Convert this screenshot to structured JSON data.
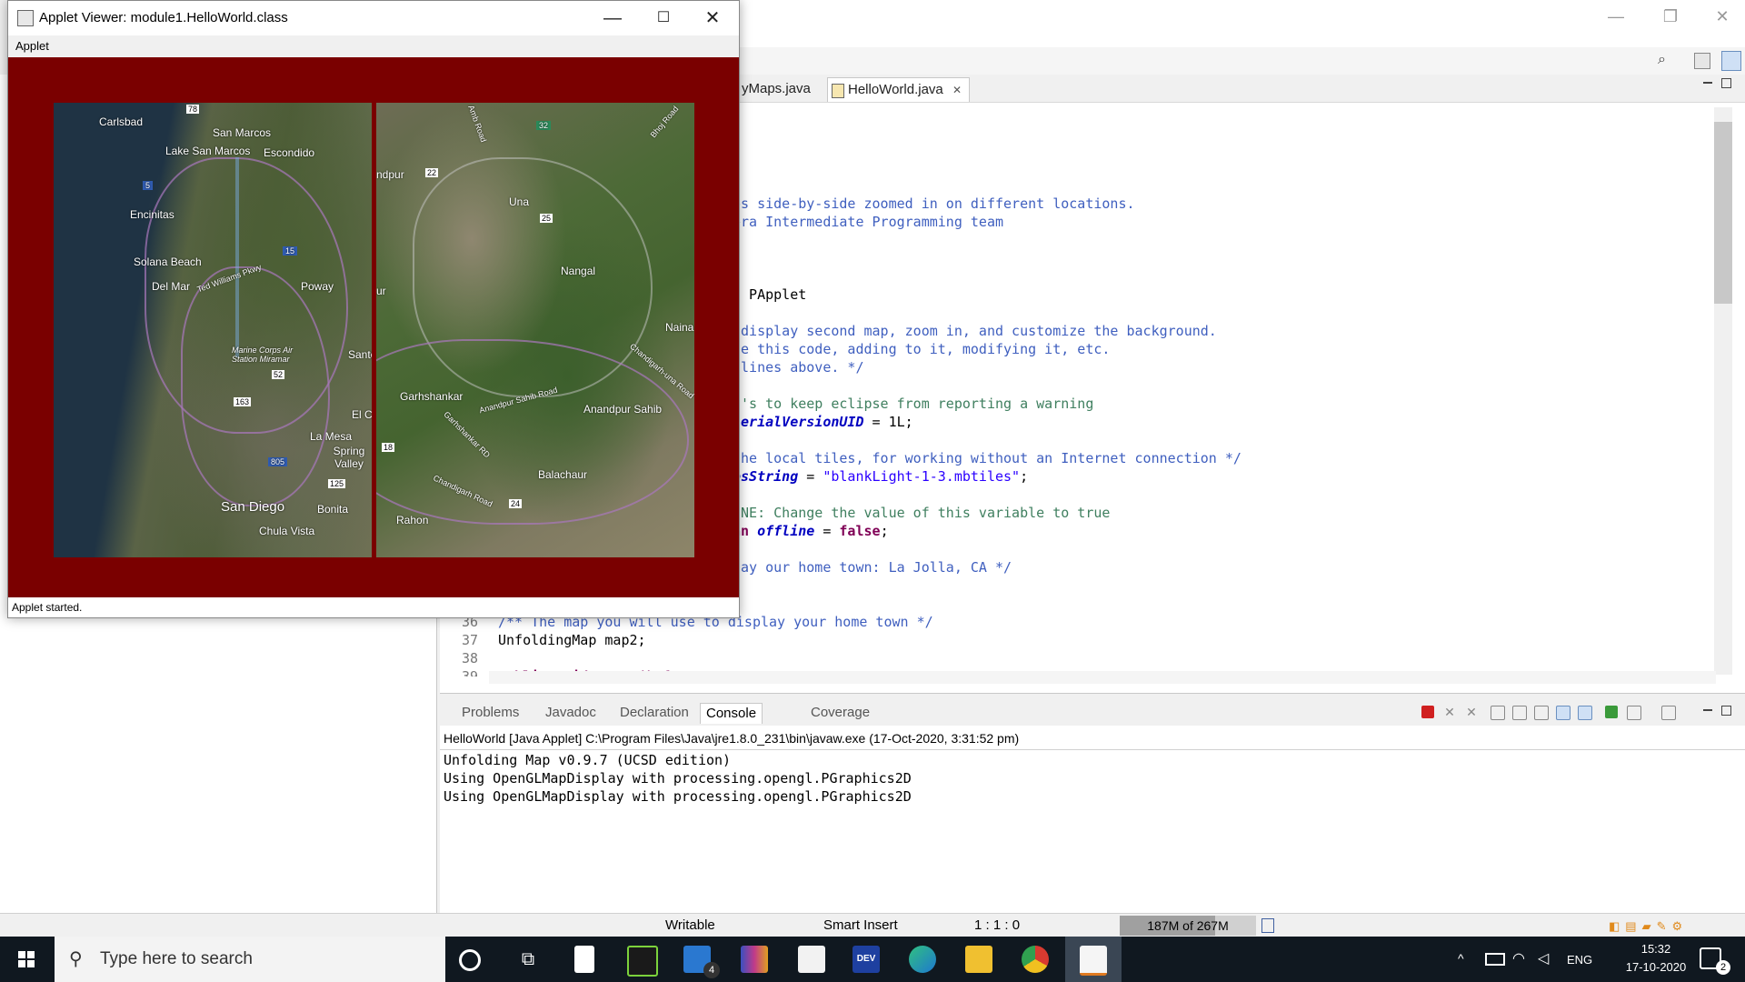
{
  "eclipse": {
    "tabs": [
      "yMaps.java",
      "HelloWorld.java"
    ],
    "code": [
      {
        "n": "",
        "t": "s",
        "cls": "kw"
      },
      {
        "n": "",
        "t": "ps side-by-side zoomed in on different locations.",
        "cls": "cmt"
      },
      {
        "n": "",
        "t": "era Intermediate Programming team",
        "cls": "cmt"
      },
      {
        "n": "",
        "t": "s PApplet",
        "cls": ""
      },
      {
        "n": "",
        "t": " display second map, zoom in, and customize the background.",
        "cls": "cmt"
      },
      {
        "n": "",
        "t": "se this code, adding to it, modifying it, etc.",
        "cls": "cmt"
      },
      {
        "n": "",
        "t": " lines above. */",
        "cls": "cmt"
      },
      {
        "n": "",
        "t": "t's to keep eclipse from reporting a warning",
        "cls": "cmt2"
      },
      {
        "n": "",
        "t": "serialVersionUID",
        "cls": "fld",
        "tail": " = 1L;"
      },
      {
        "n": "",
        "t": "the local tiles, for working without an Internet connection */",
        "cls": "cmt"
      },
      {
        "n": "",
        "t": "esString",
        "cls": "fld",
        "tail": " = ",
        "str": "\"blankLight-1-3.mbtiles\"",
        "tail2": ";"
      },
      {
        "n": "",
        "t": "INE: Change the value of this variable to true",
        "cls": "cmt2"
      },
      {
        "n": "",
        "t": "an ",
        "cls": "kw",
        "fld": "offline",
        "tail": " = ",
        "kw2": "false",
        "tail2": ";"
      },
      {
        "n": "",
        "t": "lay our home town: La Jolla, CA */",
        "cls": "cmt"
      },
      {
        "n": "36",
        "t": "/** The map you will use to display your home town */",
        "cls": "cmt"
      },
      {
        "n": "37",
        "t": "UnfoldingMap map2;",
        "cls": ""
      },
      {
        "n": "38",
        "t": "",
        "cls": ""
      },
      {
        "n": "39",
        "t": "public void setup() {",
        "cls": "kw"
      }
    ],
    "console_tabs": [
      "Problems",
      "Javadoc",
      "Declaration",
      "Console",
      "Coverage"
    ],
    "console_desc": "HelloWorld [Java Applet] C:\\Program Files\\Java\\jre1.8.0_231\\bin\\javaw.exe (17-Oct-2020, 3:31:52 pm)",
    "console_out": [
      "Unfolding Map v0.9.7 (UCSD edition)",
      "Using OpenGLMapDisplay with processing.opengl.PGraphics2D",
      "Using OpenGLMapDisplay with processing.opengl.PGraphics2D"
    ],
    "status": {
      "writable": "Writable",
      "insert": "Smart Insert",
      "position": "1 : 1 : 0",
      "heap": "187M of 267M",
      "heap_fraction": 0.7
    }
  },
  "applet": {
    "title": "Applet Viewer: module1.HelloWorld.class",
    "menu": "Applet",
    "status": "Applet started.",
    "map1_labels": [
      "Carlsbad",
      "San Marcos",
      "Lake San Marcos",
      "Escondido",
      "Encinitas",
      "Solana Beach",
      "Del Mar",
      "Poway",
      "Marine Corps Air Station Miramar",
      "Sante",
      "El Ca",
      "La Mesa",
      "Spring Valley",
      "San Diego",
      "Bonita",
      "Chula Vista",
      "Ted Williams Pkwy"
    ],
    "map1_shields": [
      "78",
      "5",
      "15",
      "52",
      "163",
      "805",
      "125"
    ],
    "map2_labels": [
      "ndpur",
      "Una",
      "Nangal",
      "Naina",
      "Garhshankar",
      "Anandpur Sahib Road",
      "Anandpur Sahib",
      "Garhshankar RD",
      "Chandigarh-una Road",
      "Balachaur",
      "Chandigarh Road",
      "Rahon",
      "Amb Road",
      "Bhoj Road",
      "ur"
    ],
    "map2_shields": [
      "32",
      "22",
      "25",
      "18",
      "24"
    ]
  },
  "taskbar": {
    "search_placeholder": "Type here to search",
    "mail_badge": "4",
    "lang": "ENG",
    "time": "15:32",
    "date": "17-10-2020",
    "notif_count": "2"
  },
  "colors": {
    "applet_bg": "#7a0000",
    "taskbar": "#101820",
    "comment": "#3f5fbf",
    "keyword": "#7f0055"
  }
}
